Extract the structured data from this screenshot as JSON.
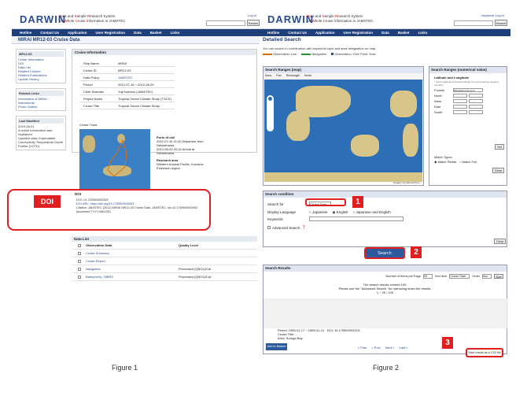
{
  "figure1": {
    "caption": "Figure 1",
    "logo": "DARWIN",
    "tagline1_parts": [
      "D",
      "ata and ",
      "S",
      "ample ",
      "R",
      "esearch System"
    ],
    "tagline2_parts": [
      "for ",
      "W",
      "hole ",
      "C",
      "ruise ",
      "I",
      "nformatio",
      "n in JAMSTEC"
    ],
    "toplinks": "Log-in",
    "search_button": "Search",
    "nav": [
      "Hotline",
      "Contact Us",
      "Application",
      "User Registration",
      "Data",
      "Basket",
      "Links"
    ],
    "page_title": "MIRAI MR12-03 Cruise Data",
    "sidebar": {
      "box1_title": "MR12-03",
      "box1_items": [
        "Cruise Information",
        "DOI",
        "Data List",
        "Related Cruises",
        "Related Publications",
        "Update History"
      ],
      "box2_title": "Related Links",
      "box2_items": [
        "Information of MIRAI",
        "Instruments",
        "Photo Gallery"
      ],
      "box3_title": "Last Modified",
      "box3_text": [
        "2019-08-01",
        "A cruise information was registered",
        "Updated data: Expendable",
        "Conductivity Temperature Depth",
        "Profiler (XCTD)"
      ]
    },
    "cruise_info_title": "Cruise Information",
    "info_rows": [
      {
        "k": "Ship Name",
        "v": "MIRAI"
      },
      {
        "k": "Cruise ID",
        "v": "MR12-03"
      },
      {
        "k": "Data Policy",
        "v": "JAMSTEC"
      },
      {
        "k": "Period",
        "v": "2012-07-16 ~ 2012-08-29"
      },
      {
        "k": "Chief Scientist",
        "v": "Yuji Kashino (JAMSTEC)"
      },
      {
        "k": "Project Name",
        "v": "Tropical Ocean Climate Study (TOCS)"
      },
      {
        "k": "Cruise Title",
        "v": "Tropical Ocean Climate Study"
      }
    ],
    "cruise_track_label": "Cruise Track",
    "ports_label": "Ports of call",
    "ports_lines": [
      "2012-07-16 21:00 Departure from Sekinehama",
      "2012-08-29 20:15 Arrival at Sekinehama"
    ],
    "research_area_label": "Research area",
    "research_area_text": "Western tropical Pacific, Kuroshio Extension region",
    "enlarge_label": "Enlarge Image",
    "doi_label": "DOI",
    "doi_section_title": "DOI",
    "doi_lines": [
      "DOI: 10.17596/0000063",
      "DOI URL: https://doi.org/10.17596/0000063",
      "Citation: JAMSTEC (2012) MIRAI MR12-03 Cruise Data. JAMSTEC. doi:10.17596/0000063 (accessed YYYY-MM-DD)"
    ],
    "data_list_title": "Data List",
    "data_list_header": [
      "Observation Data",
      "Quality Level"
    ],
    "data_rows": [
      {
        "name": "Cruise Summary",
        "ql": ""
      },
      {
        "name": "Cruise Report",
        "ql": ""
      },
      {
        "name": "Navigation",
        "ql": "Processed (QNO1)/Cal"
      },
      {
        "name": "Bathymetry / MBES",
        "ql": "Processed (QNO1)/Cal"
      }
    ]
  },
  "figure2": {
    "caption": "Figure 2",
    "logo": "DARWIN",
    "toplinks": [
      "Japanese",
      "Log-in"
    ],
    "search_button": "Search",
    "nav": [
      "Hotline",
      "Contact Us",
      "Application",
      "User Registration",
      "Data",
      "Basket",
      "Links"
    ],
    "title": "Detailed Search",
    "subtitle": "You can search in combination with keywords input and area designation on map.",
    "legend": [
      {
        "label": "Observation Line",
        "color": "#e36a00"
      },
      {
        "label": "Navigation",
        "color": "#2f8f2f"
      },
      {
        "label": "Observation, Dive Point, Hole",
        "color": "#2a4d8f"
      }
    ],
    "map_panel_title": "Search Ranges (map)",
    "map_tools": [
      "Area",
      "Pan",
      "Rectangle",
      "None"
    ],
    "map_credit": "Imagery reproduced from...",
    "num_panel_title": "Search Ranges (numerical value)",
    "latlon_title": "Latitude and Longitude",
    "latlon_note": "* Input longitude and south latitude are expressed as negative numbers.",
    "format_label": "Format",
    "format_value": "DM (ddd.mmm.mm)",
    "fields": [
      "North",
      "West",
      "East",
      "South"
    ],
    "set_button": "Set",
    "clear_button": "Clear",
    "match_types_label": "Match Types",
    "match_options": [
      "Match Partial",
      "Match Full"
    ],
    "cond_title": "Search condition",
    "search_for_label": "Search for",
    "search_for_value": "Cruise Data",
    "display_lang_label": "Display Language",
    "lang_options": [
      "Japanese",
      "English",
      "Japanese and English"
    ],
    "keywords_label": "Keywords",
    "advanced_label": "Advanced Search",
    "search_main_button": "Search",
    "results_title": "Search Results",
    "items_per_page_label": "Number of items per Page",
    "items_per_page_value": "25",
    "sort_item_label": "Sort Item",
    "sort_item_value": "Cruise Start",
    "order_label": "Order",
    "order_value": "Asc",
    "sort_button": "Sort",
    "results_line1": "The search results exceed 100.",
    "results_line2": "Please use the \"Advanced Search\" for narrowing down the results.",
    "results_line3": "1 ~ 25 / 100",
    "result_item_period": "Period: 1985-01-17 ~ 1985-01-21",
    "result_item_doi": "DOI: 10.17596/0002211",
    "result_item_title": "Cruise Title: -",
    "result_item_area": "Area: Suruga Bay",
    "pager": [
      "« First",
      "< Prev",
      "Next >",
      "Last »"
    ],
    "add_basket_button": "Add to Basket",
    "csv_button": "Save results as a CSV file",
    "markers": [
      "1",
      "2",
      "3"
    ]
  }
}
